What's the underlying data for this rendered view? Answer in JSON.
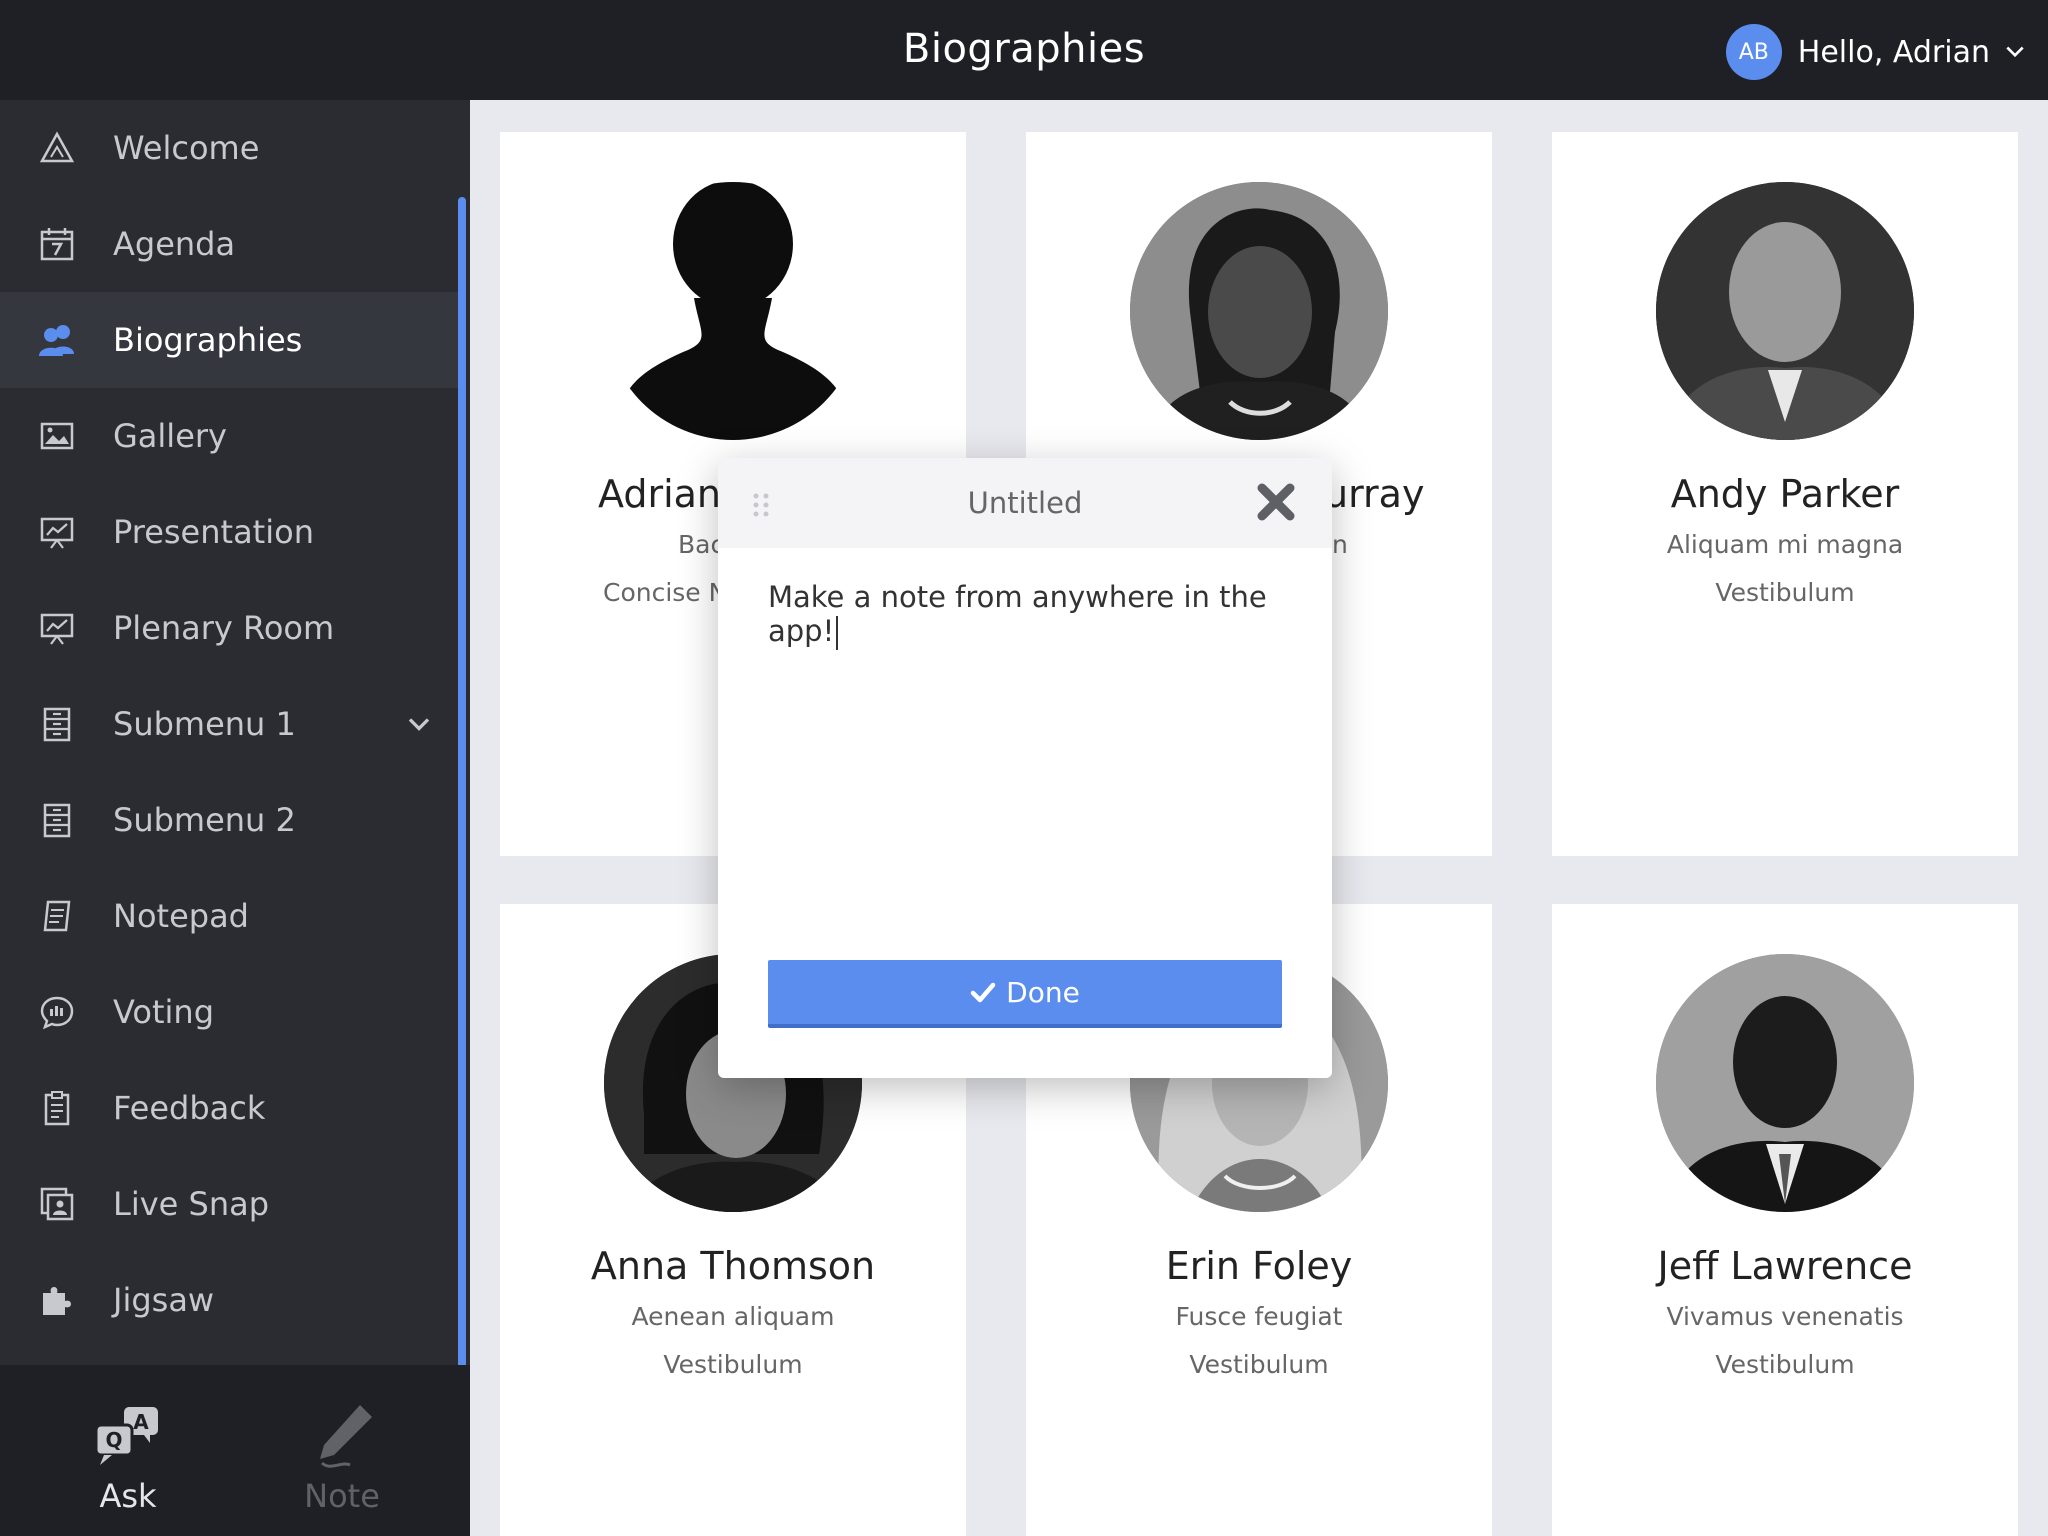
{
  "header": {
    "title": "Biographies",
    "user_initials": "AB",
    "user_greeting": "Hello, Adrian"
  },
  "sidebar": {
    "items": [
      {
        "label": "Welcome",
        "icon": "welcome-icon"
      },
      {
        "label": "Agenda",
        "icon": "calendar-icon"
      },
      {
        "label": "Biographies",
        "icon": "people-icon",
        "active": true
      },
      {
        "label": "Gallery",
        "icon": "gallery-icon"
      },
      {
        "label": "Presentation",
        "icon": "presentation-icon"
      },
      {
        "label": "Plenary Room",
        "icon": "presentation-icon"
      },
      {
        "label": "Submenu 1",
        "icon": "cabinet-icon",
        "has_submenu": true
      },
      {
        "label": "Submenu 2",
        "icon": "cabinet-icon"
      },
      {
        "label": "Notepad",
        "icon": "notepad-icon"
      },
      {
        "label": "Voting",
        "icon": "voting-icon"
      },
      {
        "label": "Feedback",
        "icon": "clipboard-icon"
      },
      {
        "label": "Live Snap",
        "icon": "live-snap-icon"
      },
      {
        "label": "Jigsaw",
        "icon": "puzzle-icon"
      }
    ],
    "footer": {
      "ask_label": "Ask",
      "note_label": "Note"
    }
  },
  "cards": [
    {
      "name": "Adrian",
      "role": "Bac",
      "org": "Concise N",
      "photo": "silhouette"
    },
    {
      "name": "urray",
      "role": "n",
      "org": "",
      "photo": "woman-1"
    },
    {
      "name": "Andy Parker",
      "role": "Aliquam mi magna",
      "org": "Vestibulum",
      "photo": "man-1"
    },
    {
      "name": "Anna Thomson",
      "role": "Aenean aliquam",
      "org": "Vestibulum",
      "photo": "woman-2"
    },
    {
      "name": "Erin Foley",
      "role": "Fusce feugiat",
      "org": "Vestibulum",
      "photo": "woman-3"
    },
    {
      "name": "Jeff Lawrence",
      "role": "Vivamus venenatis",
      "org": "Vestibulum",
      "photo": "man-2"
    }
  ],
  "note_modal": {
    "title": "Untitled",
    "text": "Make a note from anywhere in the app!",
    "done_label": "Done"
  },
  "colors": {
    "accent": "#5b8def",
    "header_bg": "#1f2025",
    "sidebar_bg": "#2a2c32"
  }
}
